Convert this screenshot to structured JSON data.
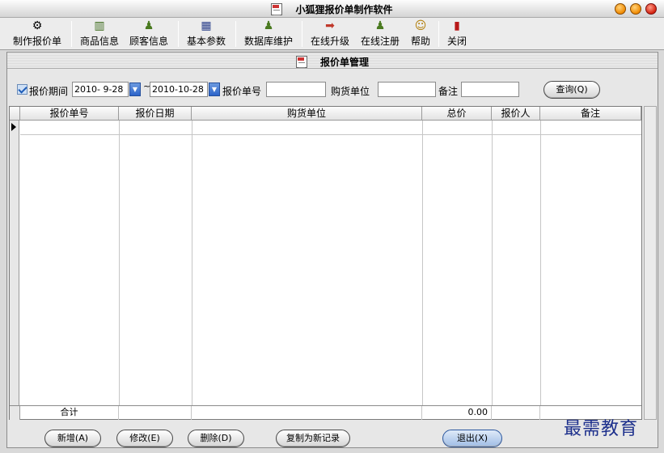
{
  "window": {
    "title": "小狐狸报价单制作软件"
  },
  "toolbar": {
    "items": [
      {
        "label": "制作报价单",
        "icon": "gear-icon"
      },
      {
        "label": "商品信息",
        "icon": "product-icon"
      },
      {
        "label": "顾客信息",
        "icon": "person-icon"
      },
      {
        "label": "基本参数",
        "icon": "grid-icon"
      },
      {
        "label": "数据库维护",
        "icon": "database-icon"
      },
      {
        "label": "在线升级",
        "icon": "upgrade-icon"
      },
      {
        "label": "在线注册",
        "icon": "register-icon"
      },
      {
        "label": "帮助",
        "icon": "help-icon"
      },
      {
        "label": "关闭",
        "icon": "close-icon"
      }
    ]
  },
  "panel": {
    "title": "报价单管理"
  },
  "filter": {
    "period_label": "报价期间",
    "date_from": "2010- 9-28",
    "date_sep": "~",
    "date_to": "2010-10-28",
    "quote_no_label": "报价单号",
    "quote_no_value": "",
    "buyer_label": "购货单位",
    "buyer_value": "",
    "note_label": "备注",
    "note_value": "",
    "query_button": "查询(Q)"
  },
  "table": {
    "columns": [
      "报价单号",
      "报价日期",
      "购货单位",
      "总价",
      "报价人",
      "备注"
    ],
    "rows": [],
    "footer": {
      "label": "合计",
      "total": "0.00"
    }
  },
  "buttons": {
    "add": "新增(A)",
    "edit": "修改(E)",
    "delete": "删除(D)",
    "copy": "复制为新记录",
    "exit": "退出(X)"
  },
  "watermark": "最需教育",
  "colors": {
    "accent": "#2b63c9",
    "window_button_orange": "#f08a00",
    "window_button_red": "#d4200c"
  }
}
